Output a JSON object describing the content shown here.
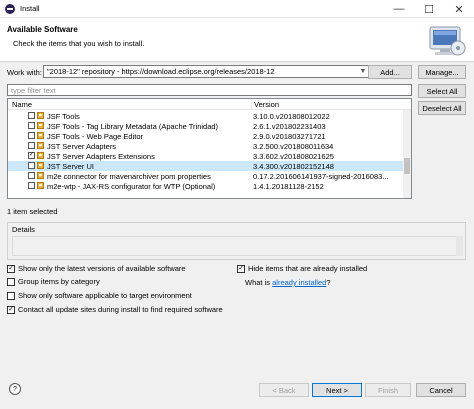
{
  "window": {
    "title": "Install",
    "minimize": "—",
    "maximize": "☐",
    "close": "✕"
  },
  "header": {
    "title": "Available Software",
    "description": "Check the items that you wish to install."
  },
  "work_with": {
    "label": "Work with:",
    "value": "\"2018-12\" repository - https://download.eclipse.org/releases/2018-12",
    "add_button": "Add...",
    "manage_button": "Manage..."
  },
  "filter": {
    "placeholder": "type filter text"
  },
  "side_buttons": {
    "select_all": "Select All",
    "deselect_all": "Deselect All"
  },
  "table": {
    "columns": [
      "Name",
      "Version"
    ],
    "rows": [
      {
        "name": "JSF Tools",
        "version": "3.10.0.v201808012022",
        "checked": false,
        "selected": false
      },
      {
        "name": "JSF Tools - Tag Library Metadata (Apache Trinidad)",
        "version": "2.6.1.v201802231403",
        "checked": false,
        "selected": false
      },
      {
        "name": "JSF Tools - Web Page Editor",
        "version": "2.9.0.v201803271721",
        "checked": false,
        "selected": false
      },
      {
        "name": "JST Server Adapters",
        "version": "3.2.500.v201808011634",
        "checked": false,
        "selected": false
      },
      {
        "name": "JST Server Adapters Extensions",
        "version": "3.3.602.v201808021625",
        "checked": true,
        "selected": false
      },
      {
        "name": "JST Server UI",
        "version": "3.4.300.v201802152148",
        "checked": false,
        "selected": true
      },
      {
        "name": "m2e connector for mavenarchiver pom properties",
        "version": "0.17.2.201606141937-signed-2016083...",
        "checked": false,
        "selected": false
      },
      {
        "name": "m2e-wtp - JAX-RS configurator for WTP (Optional)",
        "version": "1.4.1.20181128-2152",
        "checked": false,
        "selected": false
      }
    ]
  },
  "status": {
    "selected_count": "1 item selected"
  },
  "details": {
    "label": "Details"
  },
  "options": {
    "latest_versions": {
      "label": "Show only the latest versions of available software",
      "checked": true
    },
    "group_by_category": {
      "label": "Group items by category",
      "checked": false
    },
    "target_env": {
      "label": "Show only software applicable to target environment",
      "checked": false
    },
    "contact_sites": {
      "label": "Contact all update sites during install to find required software",
      "checked": true
    },
    "hide_installed": {
      "label": "Hide items that are already installed",
      "checked": true
    },
    "what_is_prefix": "What is",
    "already_installed_link": "already installed",
    "what_is_suffix": "?"
  },
  "footer": {
    "help": "?",
    "back": "< Back",
    "next": "Next >",
    "finish": "Finish",
    "cancel": "Cancel"
  }
}
